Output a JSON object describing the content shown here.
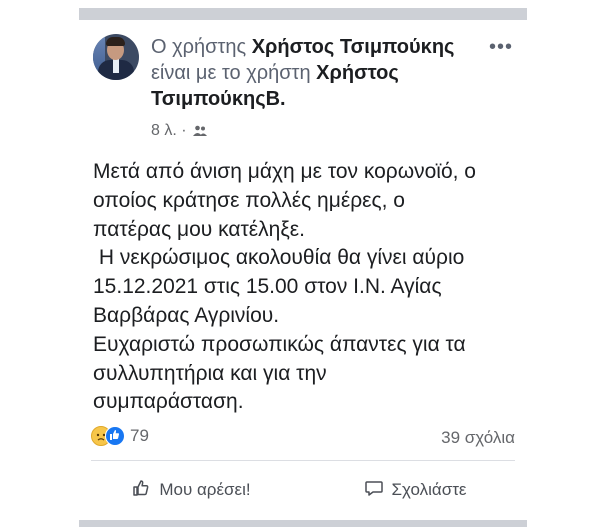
{
  "post": {
    "author_prefix": "Ο χρήστης ",
    "author_name": "Χρήστος Τσιμπούκης",
    "connector": " είναι με το χρήστη ",
    "tagged_name": "Χρήστος ΤσιμπούκηςΒ.",
    "more_label": "•••",
    "time": "8 λ. ·",
    "audience_icon": "friends-icon",
    "body": "Μετά από άνιση μάχη με τον κορωνοϊό, ο\nοποίος κράτησε πολλές ημέρες, ο\nπατέρας μου κατέληξε.\n Η νεκρώσιμος ακολουθία θα γίνει αύριο\n15.12.2021 στις 15.00 στον Ι.Ν. Αγίας\nΒαρβάρας Αγρινίου.\nΕυχαριστώ προσωπικώς άπαντες για τα\nσυλλυπητήρια και για την\nσυμπαράσταση."
  },
  "stats": {
    "reaction_count": "79",
    "comments": "39 σχόλια"
  },
  "actions": {
    "like": "Μου αρέσει!",
    "comment": "Σχολιάστε"
  },
  "colors": {
    "text": "#1c1e21",
    "secondary": "#65676b",
    "like_blue": "#1877f2",
    "sad_yellow": "#f7c64a"
  }
}
